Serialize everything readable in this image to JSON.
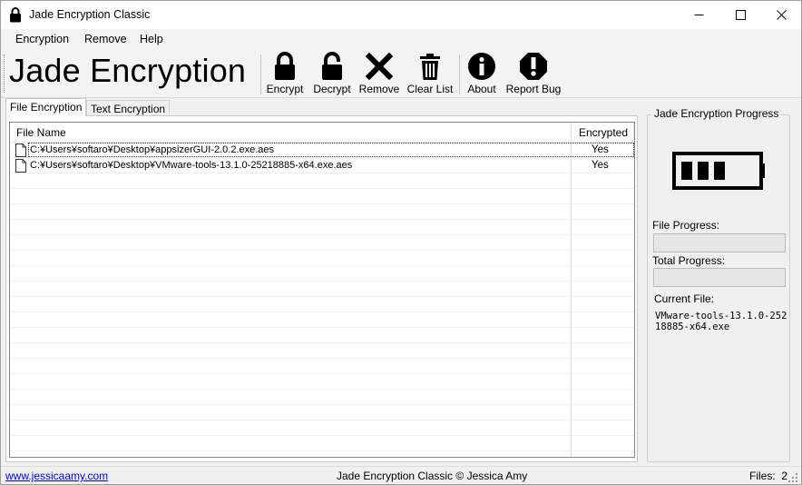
{
  "window": {
    "title": "Jade Encryption Classic",
    "buttons": {
      "minimize": "minimize-icon",
      "maximize": "maximize-icon",
      "close": "close-icon"
    }
  },
  "menu": {
    "items": [
      "Encryption",
      "Remove",
      "Help"
    ]
  },
  "toolbar": {
    "brand": "Jade Encryption",
    "buttons": [
      {
        "label": "Encrypt",
        "icon": "lock-closed-icon"
      },
      {
        "label": "Decrypt",
        "icon": "lock-open-icon"
      },
      {
        "label": "Remove",
        "icon": "x-mark-icon"
      },
      {
        "label": "Clear List",
        "icon": "trash-icon"
      },
      {
        "label": "About",
        "icon": "info-icon"
      },
      {
        "label": "Report Bug",
        "icon": "warning-icon"
      }
    ]
  },
  "tabs": [
    {
      "label": "File Encryption",
      "active": true
    },
    {
      "label": "Text Encryption",
      "active": false
    }
  ],
  "file_list": {
    "columns": [
      "File Name",
      "Encrypted"
    ],
    "rows": [
      {
        "name": "C:¥Users¥softaro¥Desktop¥appsizerGUI-2.0.2.exe.aes",
        "encrypted": "Yes"
      },
      {
        "name": "C:¥Users¥softaro¥Desktop¥VMware-tools-13.1.0-25218885-x64.exe.aes",
        "encrypted": "Yes"
      }
    ]
  },
  "progress_panel": {
    "title": "Jade Encryption Progress",
    "battery_icon": "battery-icon",
    "file_progress_label": "File Progress:",
    "file_progress": 0,
    "total_progress_label": "Total Progress:",
    "total_progress": 0,
    "current_file_label": "Current File:",
    "current_file": "VMware-tools-13.1.0-25218885-x64.exe"
  },
  "status": {
    "link": "www.jessicaamy.com",
    "center": "Jade Encryption Classic © Jessica Amy",
    "files_label": "Files:",
    "files_count": "2"
  },
  "colors": {
    "accent_link": "#0000ee",
    "progress_fill": "#06b025"
  }
}
